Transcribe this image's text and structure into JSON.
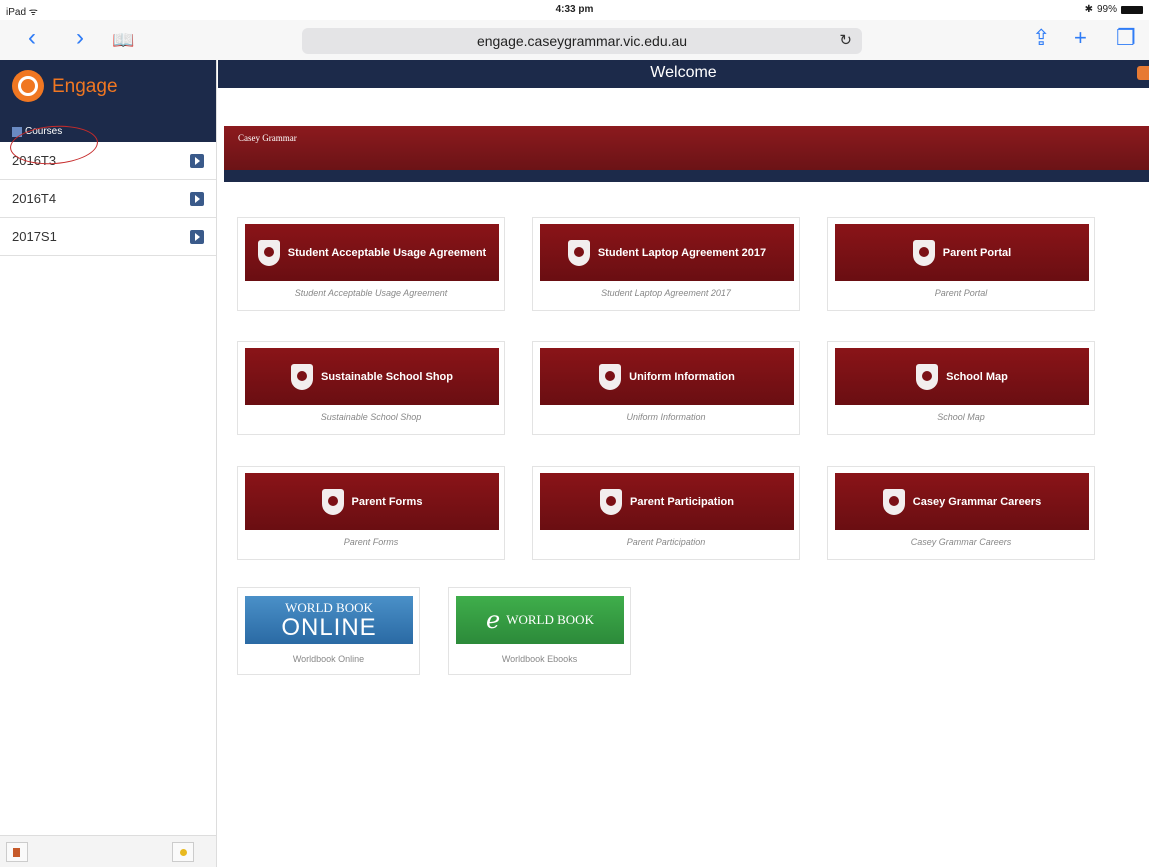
{
  "status": {
    "device": "iPad ᯤ",
    "time": "4:33 pm",
    "battery": "99%"
  },
  "browser": {
    "url": "engage.caseygrammar.vic.edu.au"
  },
  "sidebar": {
    "app_name": "Engage",
    "back_label": "Courses",
    "items": [
      {
        "label": "2016T3"
      },
      {
        "label": "2016T4"
      },
      {
        "label": "2017S1"
      }
    ]
  },
  "main": {
    "title": "Welcome",
    "banner_logo": "Casey Grammar",
    "tiles": [
      {
        "label": "Student Acceptable Usage Agreement",
        "caption": "Student Acceptable Usage Agreement"
      },
      {
        "label": "Student Laptop Agreement 2017",
        "caption": "Student Laptop Agreement 2017"
      },
      {
        "label": "Parent Portal",
        "caption": "Parent Portal"
      },
      {
        "label": "Sustainable School Shop",
        "caption": "Sustainable School Shop"
      },
      {
        "label": "Uniform Information",
        "caption": "Uniform Information"
      },
      {
        "label": "School Map",
        "caption": "School Map"
      },
      {
        "label": "Parent Forms",
        "caption": "Parent Forms"
      },
      {
        "label": "Parent Participation",
        "caption": "Parent Participation"
      },
      {
        "label": "Casey Grammar Careers",
        "caption": "Casey Grammar Careers"
      }
    ],
    "worldbook": [
      {
        "line1": "WORLD BOOK",
        "line2": "ONLINE",
        "caption": "Worldbook Online"
      },
      {
        "line1": "WORLD BOOK",
        "caption": "Worldbook Ebooks"
      }
    ]
  }
}
